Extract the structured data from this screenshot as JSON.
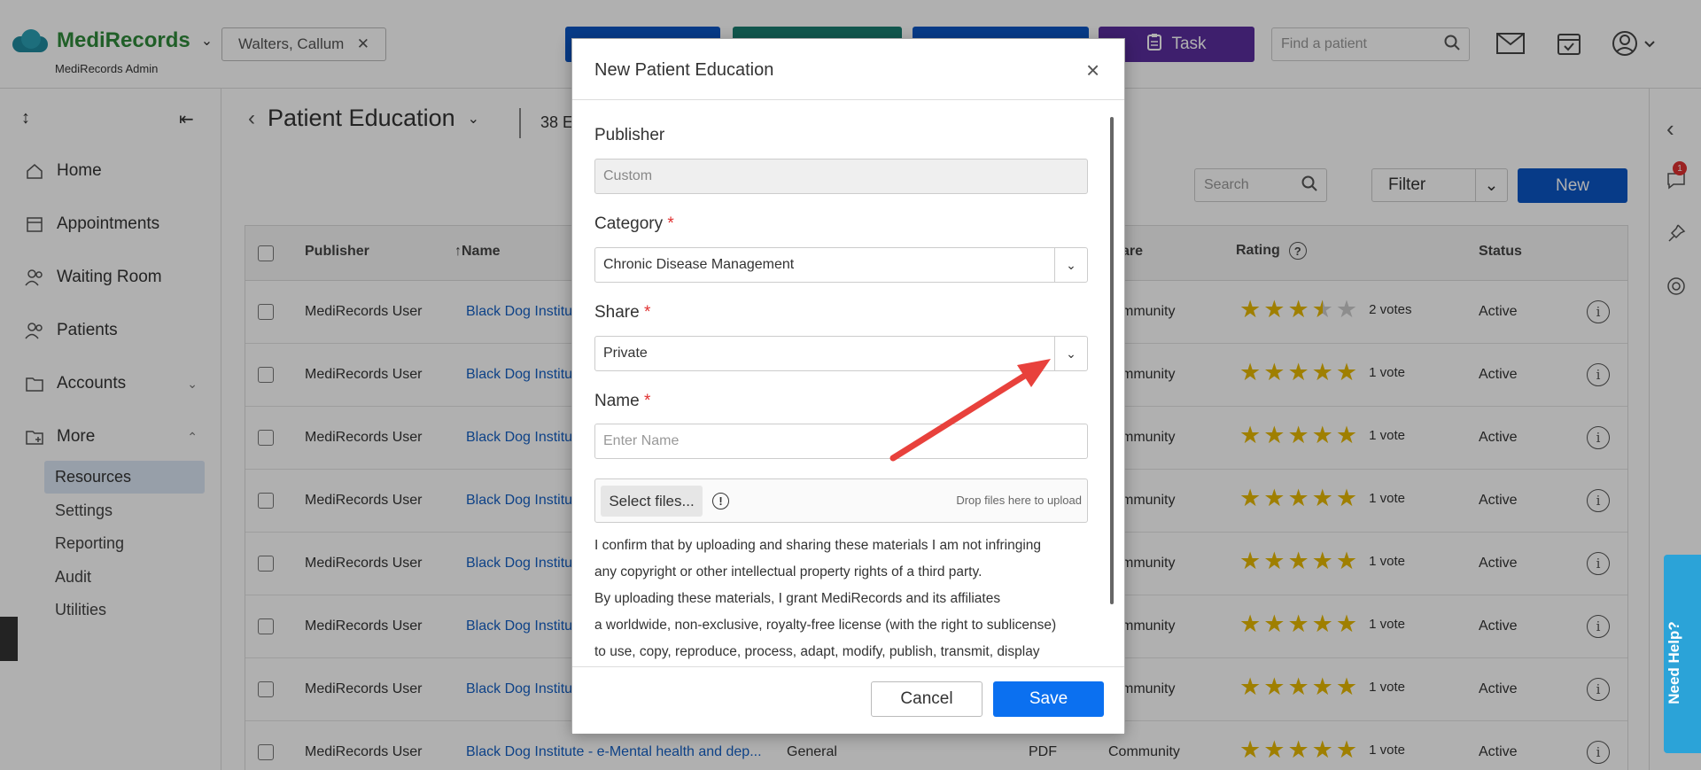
{
  "app": {
    "logo_text": "MediRecords",
    "logo_sub": "MediRecords Admin",
    "patient_chip": "Walters, Callum",
    "task_button": "Task",
    "find_patient_placeholder": "Find a patient",
    "colors": {
      "brand_green": "#2f8a3a",
      "primary_blue": "#0b56c6",
      "task_purple": "#5b2d9e",
      "teal": "#1a7f70",
      "star": "#e6b800",
      "required": "#e03131"
    }
  },
  "sidebar": {
    "items": [
      {
        "label": "Home",
        "icon": "home-icon"
      },
      {
        "label": "Appointments",
        "icon": "calendar-icon"
      },
      {
        "label": "Waiting Room",
        "icon": "people-icon"
      },
      {
        "label": "Patients",
        "icon": "patients-icon"
      },
      {
        "label": "Accounts",
        "icon": "folder-icon"
      },
      {
        "label": "More",
        "icon": "folder-plus-icon"
      }
    ],
    "subitems": [
      "Resources",
      "Settings",
      "Reporting",
      "Audit",
      "Utilities"
    ]
  },
  "page": {
    "title": "Patient Education",
    "count_text": "38 E",
    "search_placeholder": "Search",
    "filter_label": "Filter",
    "new_label": "New"
  },
  "table": {
    "columns": [
      "Publisher",
      "Name",
      "are",
      "Rating",
      "Status"
    ],
    "rows": [
      {
        "publisher": "MediRecords User",
        "name": "Black Dog Institu",
        "share": "mmunity",
        "stars": 3.5,
        "votes": "2 votes",
        "status": "Active"
      },
      {
        "publisher": "MediRecords User",
        "name": "Black Dog Institu",
        "share": "mmunity",
        "stars": 5,
        "votes": "1 vote",
        "status": "Active"
      },
      {
        "publisher": "MediRecords User",
        "name": "Black Dog Institu",
        "share": "mmunity",
        "stars": 5,
        "votes": "1 vote",
        "status": "Active"
      },
      {
        "publisher": "MediRecords User",
        "name": "Black Dog Institu",
        "share": "mmunity",
        "stars": 5,
        "votes": "1 vote",
        "status": "Active"
      },
      {
        "publisher": "MediRecords User",
        "name": "Black Dog Institu",
        "share": "mmunity",
        "stars": 5,
        "votes": "1 vote",
        "status": "Active"
      },
      {
        "publisher": "MediRecords User",
        "name": "Black Dog Institu",
        "share": "mmunity",
        "stars": 5,
        "votes": "1 vote",
        "status": "Active"
      },
      {
        "publisher": "MediRecords User",
        "name": "Black Dog Institu",
        "share": "mmunity",
        "stars": 5,
        "votes": "1 vote",
        "status": "Active"
      },
      {
        "publisher": "MediRecords User",
        "name": "Black Dog Institute - e-Mental health and dep...",
        "category": "General",
        "type": "PDF",
        "share": "Community",
        "stars": 5,
        "votes": "1 vote",
        "status": "Active"
      }
    ]
  },
  "modal": {
    "title": "New Patient Education",
    "publisher_label": "Publisher",
    "publisher_value": "Custom",
    "category_label": "Category",
    "category_value": "Chronic Disease Management",
    "share_label": "Share",
    "share_value": "Private",
    "name_label": "Name",
    "name_placeholder": "Enter Name",
    "select_files": "Select files...",
    "drop_files": "Drop files here to upload",
    "confirm_lines": [
      "I confirm that by uploading and sharing these materials I am not infringing",
      "any copyright or other intellectual property rights of a third party.",
      "By uploading these materials, I grant MediRecords and its affiliates",
      "a worldwide, non-exclusive, royalty-free license (with the right to sublicense)",
      "to use, copy, reproduce, process, adapt, modify, publish, transmit, display"
    ],
    "cancel": "Cancel",
    "save": "Save"
  },
  "help": {
    "need_help": "Need Help?",
    "chat_badge": "1"
  }
}
